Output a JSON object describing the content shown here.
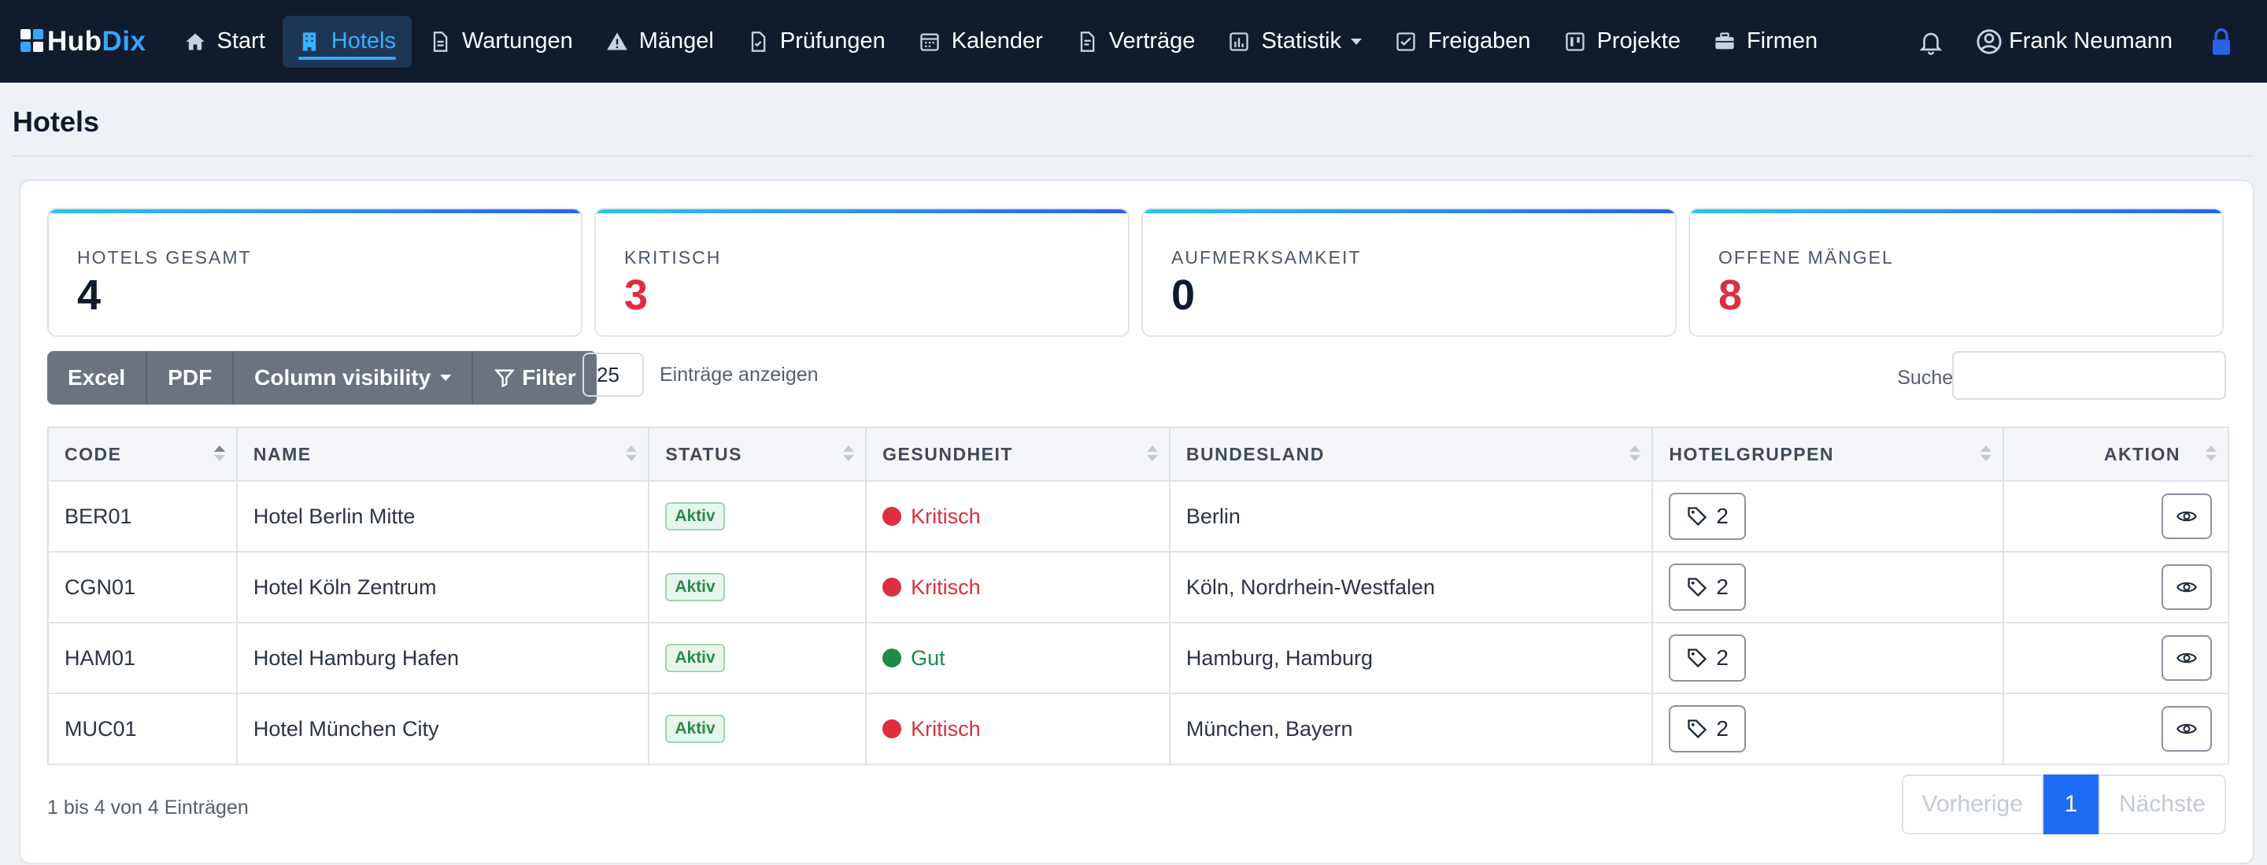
{
  "brand": {
    "part1": "Hub",
    "part2": "Dix"
  },
  "nav": {
    "items": [
      {
        "label": "Start",
        "icon": "home-icon"
      },
      {
        "label": "Hotels",
        "icon": "building-icon",
        "active": true
      },
      {
        "label": "Wartungen",
        "icon": "document-icon"
      },
      {
        "label": "Mängel",
        "icon": "warning-icon"
      },
      {
        "label": "Prüfungen",
        "icon": "file-check-icon"
      },
      {
        "label": "Kalender",
        "icon": "calendar-icon"
      },
      {
        "label": "Verträge",
        "icon": "contract-icon"
      },
      {
        "label": "Statistik",
        "icon": "bar-chart-icon",
        "dropdown": true
      },
      {
        "label": "Freigaben",
        "icon": "check-square-icon"
      },
      {
        "label": "Projekte",
        "icon": "kanban-icon"
      },
      {
        "label": "Firmen",
        "icon": "briefcase-icon"
      }
    ],
    "user_name": "Frank Neumann"
  },
  "page": {
    "title": "Hotels"
  },
  "stats": [
    {
      "label": "HOTELS GESAMT",
      "value": "4",
      "color": "#0f1a2c"
    },
    {
      "label": "KRITISCH",
      "value": "3",
      "color": "#dc2e3f"
    },
    {
      "label": "AUFMERKSAMKEIT",
      "value": "0",
      "color": "#0f1a2c"
    },
    {
      "label": "OFFENE MÄNGEL",
      "value": "8",
      "color": "#dc2e3f"
    }
  ],
  "toolbar": {
    "excel": "Excel",
    "pdf": "PDF",
    "column_visibility": "Column visibility",
    "filter": "Filter",
    "length_value": "25",
    "length_label": "Einträge anzeigen",
    "search_label": "Suchen:",
    "search_value": ""
  },
  "table": {
    "headers": [
      "CODE",
      "NAME",
      "STATUS",
      "GESUNDHEIT",
      "BUNDESLAND",
      "HOTELGRUPPEN",
      "AKTION"
    ],
    "rows": [
      {
        "code": "BER01",
        "name": "Hotel Berlin Mitte",
        "status": "Aktiv",
        "health": "Kritisch",
        "health_color": "#dc2e3f",
        "state": "Berlin",
        "groups": "2"
      },
      {
        "code": "CGN01",
        "name": "Hotel Köln Zentrum",
        "status": "Aktiv",
        "health": "Kritisch",
        "health_color": "#dc2e3f",
        "state": "Köln, Nordrhein-Westfalen",
        "groups": "2"
      },
      {
        "code": "HAM01",
        "name": "Hotel Hamburg Hafen",
        "status": "Aktiv",
        "health": "Gut",
        "health_color": "#1d8a4c",
        "state": "Hamburg, Hamburg",
        "groups": "2"
      },
      {
        "code": "MUC01",
        "name": "Hotel München City",
        "status": "Aktiv",
        "health": "Kritisch",
        "health_color": "#dc2e3f",
        "state": "München, Bayern",
        "groups": "2"
      }
    ]
  },
  "footer": {
    "info": "1 bis 4 von 4 Einträgen",
    "prev": "Vorherige",
    "current": "1",
    "next": "Nächste"
  }
}
